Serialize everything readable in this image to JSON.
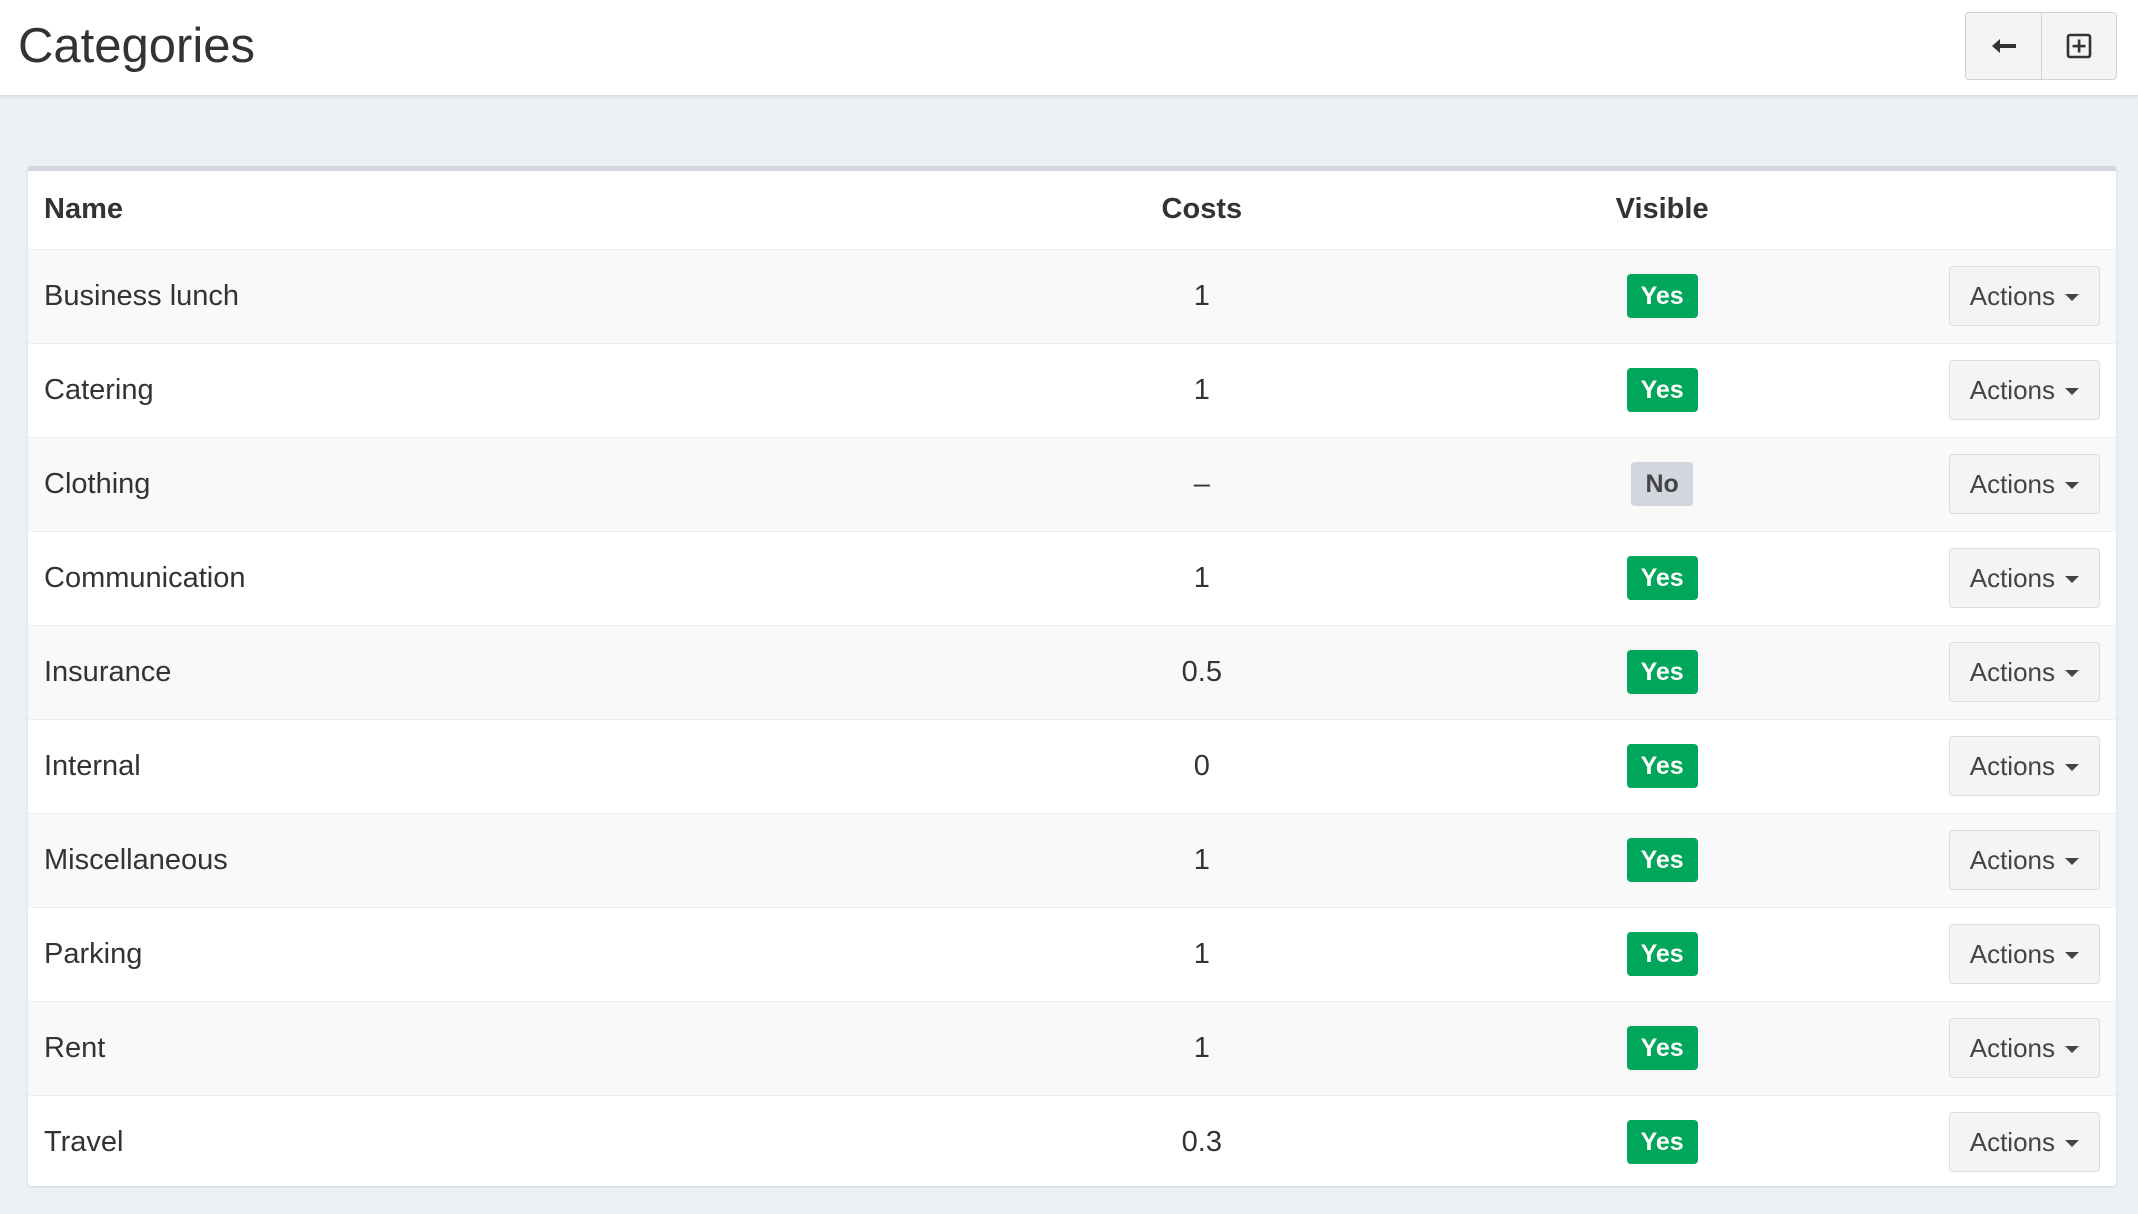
{
  "header": {
    "title": "Categories",
    "back_icon": "arrow-left-icon",
    "create_icon": "plus-square-icon"
  },
  "table": {
    "columns": [
      "Name",
      "Costs",
      "Visible",
      ""
    ],
    "rows": [
      {
        "name": "Business lunch",
        "costs": "1",
        "visible": "Yes",
        "action": "Actions"
      },
      {
        "name": "Catering",
        "costs": "1",
        "visible": "Yes",
        "action": "Actions"
      },
      {
        "name": "Clothing",
        "costs": "–",
        "visible": "No",
        "action": "Actions"
      },
      {
        "name": "Communication",
        "costs": "1",
        "visible": "Yes",
        "action": "Actions"
      },
      {
        "name": "Insurance",
        "costs": "0.5",
        "visible": "Yes",
        "action": "Actions"
      },
      {
        "name": "Internal",
        "costs": "0",
        "visible": "Yes",
        "action": "Actions"
      },
      {
        "name": "Miscellaneous",
        "costs": "1",
        "visible": "Yes",
        "action": "Actions"
      },
      {
        "name": "Parking",
        "costs": "1",
        "visible": "Yes",
        "action": "Actions"
      },
      {
        "name": "Rent",
        "costs": "1",
        "visible": "Yes",
        "action": "Actions"
      },
      {
        "name": "Travel",
        "costs": "0.3",
        "visible": "Yes",
        "action": "Actions"
      }
    ]
  },
  "colors": {
    "yes_badge": "#00a65a",
    "no_badge": "#d2d6de",
    "page_bg": "#ecf0f5"
  }
}
